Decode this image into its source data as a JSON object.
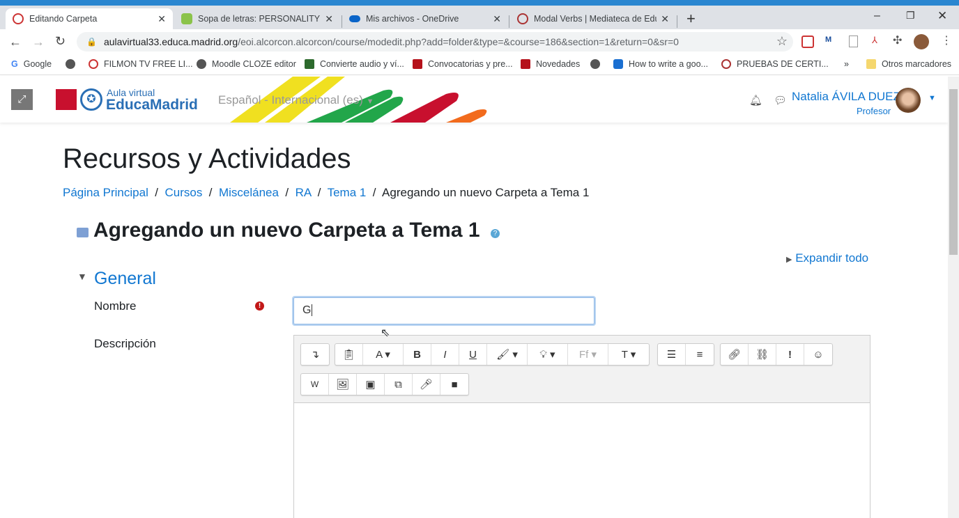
{
  "browser": {
    "tabs": [
      {
        "title": "Editando Carpeta",
        "active": true
      },
      {
        "title": "Sopa de letras: PERSONALITY AD"
      },
      {
        "title": "Mis archivos - OneDrive"
      },
      {
        "title": "Modal Verbs | Mediateca de Educ"
      }
    ],
    "url_host": "aulavirtual33.educa.madrid.org",
    "url_path": "/eoi.alcorcon.alcorcon/course/modedit.php?add=folder&type=&course=186&section=1&return=0&sr=0",
    "bookmarks": [
      "Google",
      "",
      "FILMON TV FREE LI...",
      "Moodle CLOZE editor",
      "Convierte audio y ví...",
      "Convocatorias y pre...",
      "Novedades",
      "",
      "How to write a goo...",
      "PRUEBAS DE CERTI..."
    ],
    "other_bookmarks": "Otros marcadores"
  },
  "header": {
    "logo_top": "Aula virtual",
    "logo_bottom": "EducaMadrid",
    "language": "Español - Internacional (es)",
    "user_name": "Natalia ÁVILA DUEZ",
    "user_role": "Profesor"
  },
  "page": {
    "title": "Recursos y Actividades",
    "breadcrumb": [
      "Página Principal",
      "Cursos",
      "Miscelánea",
      "RA",
      "Tema 1"
    ],
    "breadcrumb_current": "Agregando un nuevo Carpeta a Tema 1",
    "heading": "Agregando un nuevo Carpeta a Tema 1",
    "expand_all": "Expandir todo",
    "section": "General",
    "name_label": "Nombre",
    "name_value": "G",
    "description_label": "Descripción"
  },
  "colors": {
    "accent": "#1177d1",
    "topbar": "#2a86d0"
  }
}
